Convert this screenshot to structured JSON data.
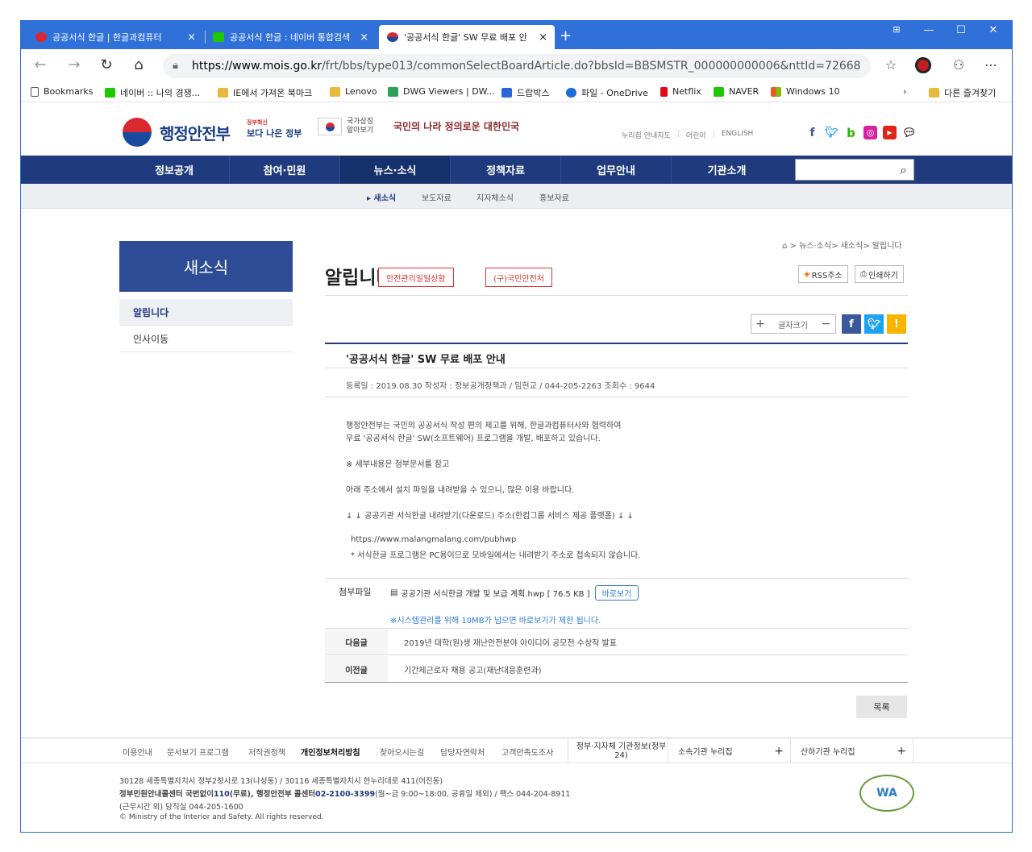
{
  "browser": {
    "tabs": [
      {
        "label": "공공서식 한글 | 한글과컴퓨터"
      },
      {
        "label": "공공서식 한글 : 네이버 통합검색"
      },
      {
        "label": "'공공서식 한글' SW 무료 배포 안"
      }
    ],
    "new_tab": "+",
    "url_host": "https://www.mois.go.kr",
    "url_path": "/frt/bbs/type013/commonSelectBoardArticle.do?bbsId=BBSMSTR_000000000006&nttId=72668",
    "bookmarks": [
      {
        "label": "Bookmarks"
      },
      {
        "label": "네이버 :: 나의 경쟁..."
      },
      {
        "label": "IE에서 가져온 북마크"
      },
      {
        "label": "Lenovo"
      },
      {
        "label": "DWG Viewers | DW..."
      },
      {
        "label": "드랍박스"
      },
      {
        "label": "파일 - OneDrive"
      },
      {
        "label": "Netflix"
      },
      {
        "label": "NAVER"
      },
      {
        "label": "Windows 10"
      },
      {
        "label": "다른 즐겨찾기"
      }
    ],
    "colors": {
      "titlebar": "#2f71d9",
      "gnb": "#1f3b7d"
    }
  },
  "header": {
    "logo": "행정안전부",
    "badge1_top": "정부혁신",
    "badge1": "보다 나은 정부",
    "badge2_line1": "국가상징",
    "badge2_line2": "알아보기",
    "badge3": "국민의 나라 정의로운 대한민국",
    "top_links": [
      "누리집 안내지도",
      "어린이",
      "ENGLISH"
    ]
  },
  "gnb": {
    "items": [
      "정보공개",
      "참여·민원",
      "뉴스·소식",
      "정책자료",
      "업무안내",
      "기관소개"
    ],
    "search_placeholder": ""
  },
  "lnb": {
    "items": [
      "▸ 새소식",
      "보도자료",
      "지자체소식",
      "홍보자료"
    ]
  },
  "breadcrumb": "> 뉴스·소식> 새소식> 알립니다",
  "side": {
    "title": "새소식",
    "items": [
      "알립니다",
      "인사이동"
    ]
  },
  "content": {
    "title": "알립니다",
    "tags": [
      "안전관리일일상황",
      "(구)국민안전처"
    ],
    "rss": "RSS주소",
    "print": "인쇄하기",
    "font_label": "글자크기",
    "font_plus": "+",
    "font_minus": "−"
  },
  "article": {
    "title": "'공공서식 한글' SW 무료 배포 안내",
    "meta": "등록일 : 2019.08.30    작성자 : 정보공개정책과 / 임현교 / 044-205-2263    조회수 : 9644",
    "lines": [
      "행정안전부는 국민의 공공서식 작성 편의 제고를 위해, 한글과컴퓨터사와 협력하여",
      "무료 '공공서식 한글' SW(소프트웨어) 프로그램을 개발, 배포하고 있습니다.",
      "※ 세부내용은 첨부문서를 참고",
      "아래 주소에서 설치 파일을 내려받을 수 있으니, 많은 이용 바랍니다.",
      "↓ ↓ 공공기관 서식한글 내려받기(다운로드) 주소(한컴그룹 서비스 제공 플랫폼) ↓ ↓",
      "https://www.malangmalang.com/pubhwp",
      "* 서식한글 프로그램은 PC용이므로 모바일에서는 내려받기 주소로 접속되지 않습니다."
    ],
    "attach_label": "첨부파일",
    "attach_file": "공공기관 서식한글 개발 및 보급 계획.hwp  [ 76.5 KB ]",
    "view_button": "바로보기",
    "notice": "※시스템관리를 위해 10MB가 넘으면 바로보기가 제한 됩니다.",
    "next_label": "다음글",
    "next_title": "2019년 대학(원)생 재난안전분야 아이디어 공모전 수상작 발표",
    "prev_label": "이전글",
    "prev_title": "기간제근로자 채용 공고(재난대응훈련과)",
    "list_button": "목록"
  },
  "footer": {
    "links": [
      "이용안내",
      "문서보기 프로그램",
      "저작권정책",
      "개인정보처리방침",
      "찾아오시는길",
      "담당자연락처",
      "고객만족도조사"
    ],
    "box1": "정부·지자체 기관정보(정부24)",
    "box2": "소속기관 누리집",
    "box3": "산하기관 누리집",
    "address": "30128 세종특별자치시 정부2청사로 13(나성동) / 30116 세종특별자치시 한누리대로 411(어진동)",
    "call_a": "정부민원안내콜센터 국번없이",
    "call_b": "110",
    "call_c": "(무료), 행정안전부 콜센터",
    "call_d": "02-2100-3399",
    "call_e": "(월~금 9:00~18:00, 공휴일 제외) / 팩스 044-204-8911",
    "night": "(근무시간 외) 당직실 044-205-1600",
    "copyright": "© Ministry of the Interior and Safety. All rights reserved.",
    "wa_mark": "WA"
  }
}
